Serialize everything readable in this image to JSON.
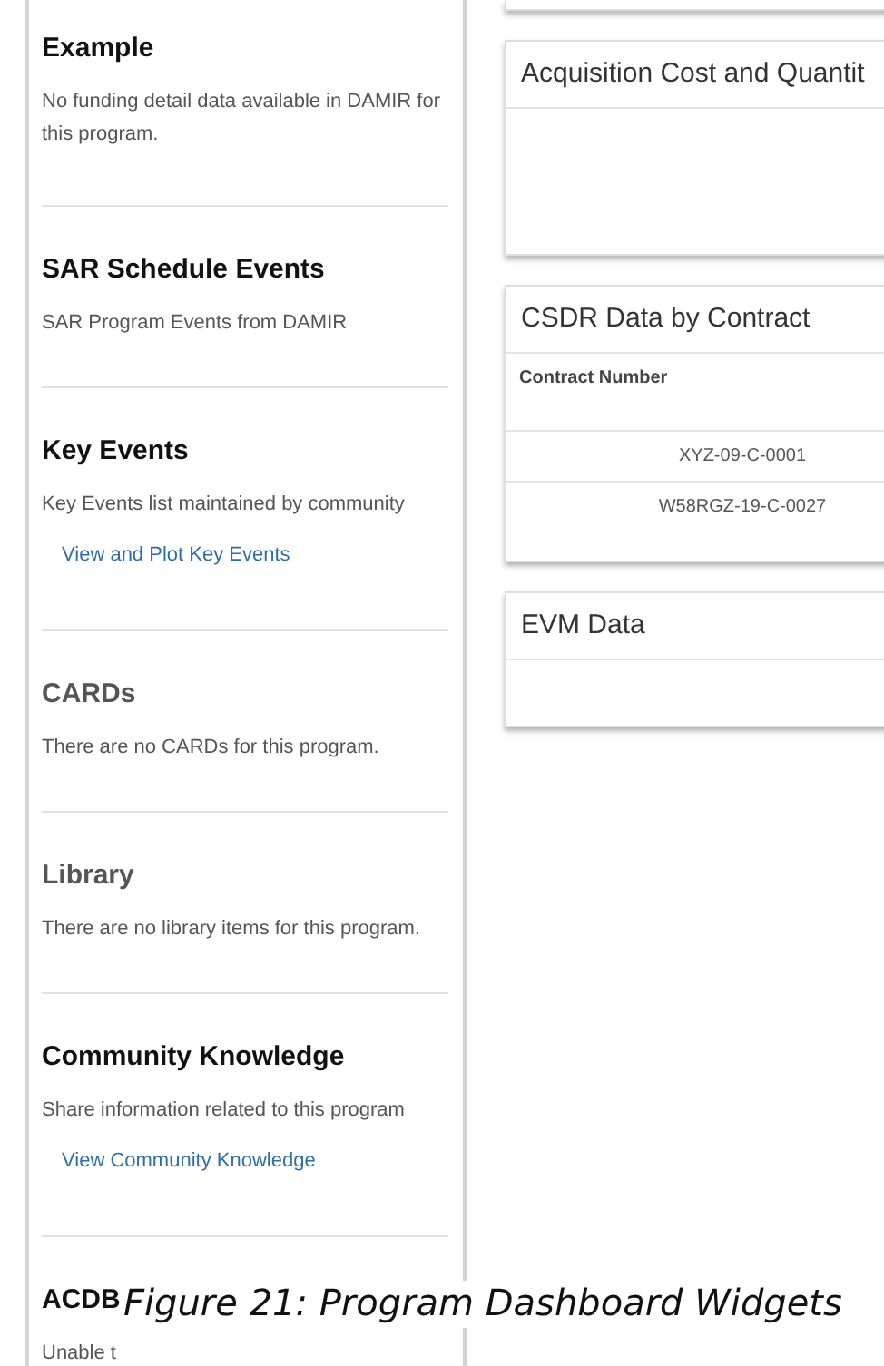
{
  "sidebar": {
    "sections": [
      {
        "title": "Example",
        "muted": false,
        "description": "No funding detail data available in DAMIR for this program."
      },
      {
        "title": "SAR Schedule Events",
        "muted": false,
        "description": "SAR Program Events from DAMIR"
      },
      {
        "title": "Key Events",
        "muted": false,
        "description": "Key Events list maintained by community",
        "link": "View and Plot Key Events"
      },
      {
        "title": "CARDs",
        "muted": true,
        "description": "There are no CARDs for this program."
      },
      {
        "title": "Library",
        "muted": true,
        "description": "There are no library items for this program."
      },
      {
        "title": "Community Knowledge",
        "muted": false,
        "description": "Share information related to this program",
        "link": "View Community Knowledge"
      },
      {
        "title": "ACDB",
        "muted": false,
        "description": "Unable t"
      }
    ]
  },
  "widgets": [
    {
      "kind": "edge"
    },
    {
      "kind": "empty",
      "title": "Acquisition Cost and Quantit"
    },
    {
      "kind": "table",
      "title": "CSDR Data by Contract",
      "columns": [
        "Contract Number"
      ],
      "rows": [
        "XYZ-09-C-0001",
        "W58RGZ-19-C-0027"
      ]
    },
    {
      "kind": "empty",
      "title": "EVM Data"
    }
  ],
  "caption": "Figure 21: Program Dashboard Widgets"
}
